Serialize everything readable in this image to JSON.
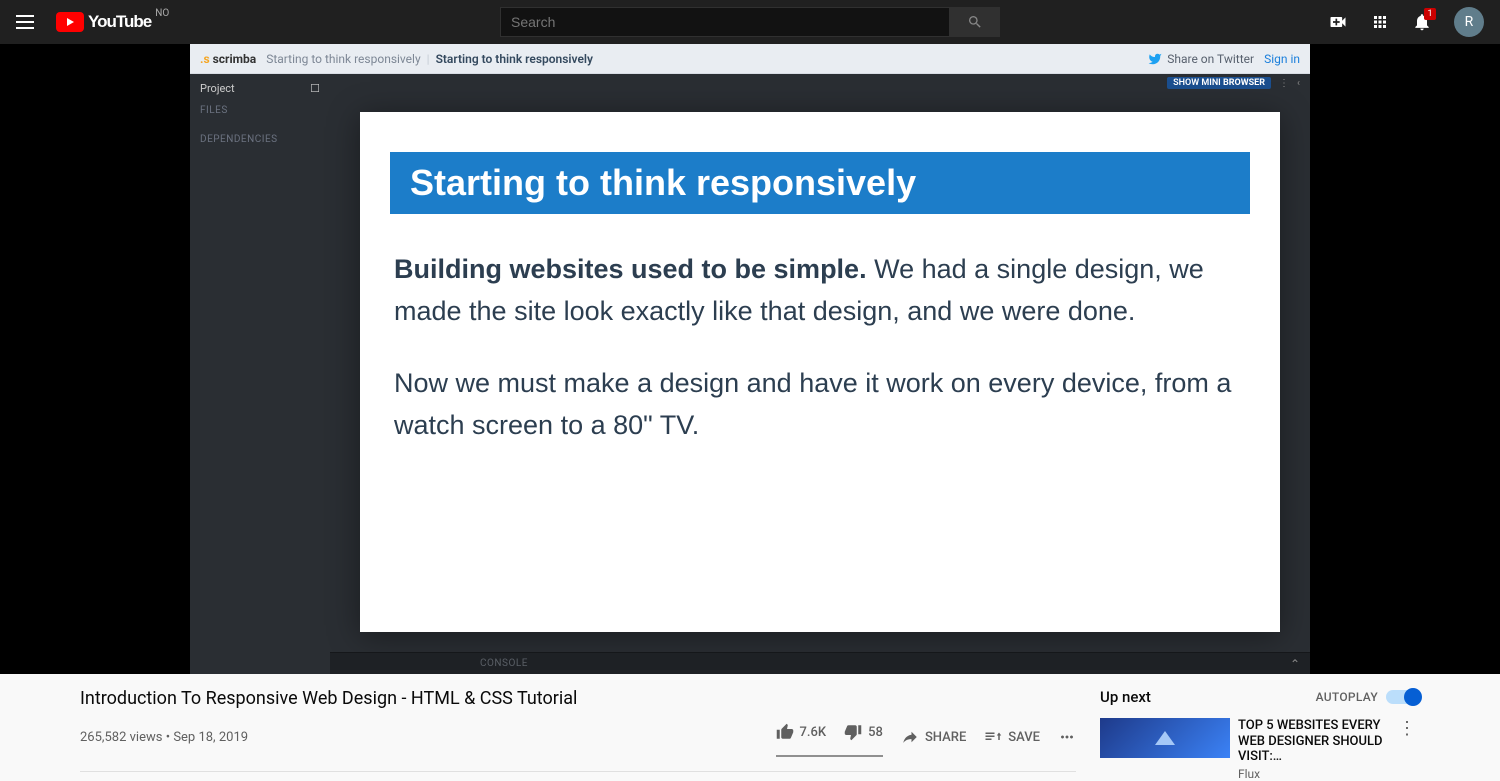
{
  "header": {
    "region": "NO",
    "search_placeholder": "Search",
    "notification_count": "1",
    "avatar_letter": "R"
  },
  "scrimba": {
    "logo": "scrimba",
    "breadcrumb1": "Starting to think responsively",
    "breadcrumb2": "Starting to think responsively",
    "share_label": "Share on Twitter",
    "signin": "Sign in",
    "sidebar": {
      "project": "Project",
      "project_icon": "☐",
      "files": "FILES",
      "deps": "DEPENDENCIES"
    },
    "mini_browser_btn": "SHOW MINI BROWSER",
    "console": "CONSOLE",
    "slide": {
      "heading": "Starting to think responsively",
      "p1_strong": "Building websites used to be simple.",
      "p1_rest": " We had a single design, we made the site look exactly like that design, and we were done.",
      "p2": "Now we must make a design and have it work on every device, from a watch screen to a 80\" TV."
    }
  },
  "video": {
    "title": "Introduction To Responsive Web Design - HTML & CSS Tutorial",
    "views": "265,582 views",
    "date": "Sep 18, 2019",
    "likes": "7.6K",
    "dislikes": "58",
    "share": "SHARE",
    "save": "SAVE"
  },
  "upnext": {
    "label": "Up next",
    "autoplay": "AUTOPLAY",
    "item": {
      "title": "TOP 5 WEBSITES EVERY WEB DESIGNER SHOULD VISIT:…",
      "channel": "Flux"
    }
  }
}
